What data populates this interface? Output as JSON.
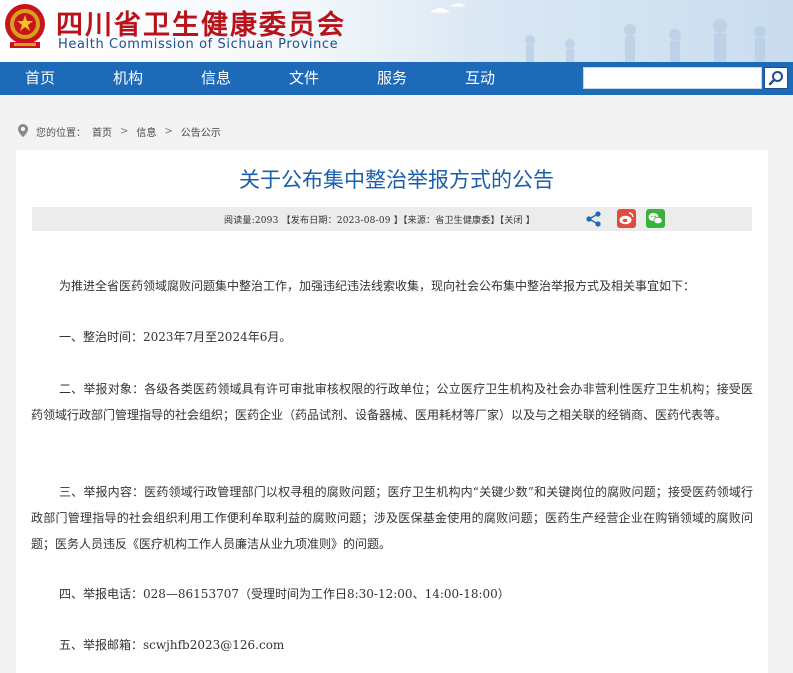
{
  "header": {
    "title_cn": "四川省卫生健康委员会",
    "title_en": "Health Commission of Sichuan Province"
  },
  "nav": {
    "items": [
      {
        "label": "首页"
      },
      {
        "label": "机构"
      },
      {
        "label": "信息"
      },
      {
        "label": "文件"
      },
      {
        "label": "服务"
      },
      {
        "label": "互动"
      }
    ]
  },
  "search": {
    "value": "",
    "icon": "search-icon"
  },
  "breadcrumb": {
    "prefix": "您的位置：",
    "items": [
      "首页",
      "信息",
      "公告公示"
    ],
    "separator": ">"
  },
  "article": {
    "title": "关于公布集中整治举报方式的公告",
    "meta": "阅读量:2093 【发布日期：2023-08-09 】【来源：省卫生健康委】【关闭 】",
    "paragraphs": [
      "为推进全省医药领域腐败问题集中整治工作，加强违纪违法线索收集，现向社会公布集中整治举报方式及相关事宜如下：",
      "一、整治时间：2023年7月至2024年6月。",
      "二、举报对象：各级各类医药领域具有许可审批审核权限的行政单位；公立医疗卫生机构及社会办非营利性医疗卫生机构；接受医药领域行政部门管理指导的社会组织；医药企业（药品试剂、设备器械、医用耗材等厂家）以及与之相关联的经销商、医药代表等。",
      "三、举报内容：医药领域行政管理部门以权寻租的腐败问题；医疗卫生机构内“关键少数”和关键岗位的腐败问题；接受医药领域行政部门管理指导的社会组织利用工作便利牟取利益的腐败问题；涉及医保基金使用的腐败问题；医药生产经营企业在购销领域的腐败问题；医务人员违反《医疗机构工作人员廉洁从业九项准则》的问题。",
      "四、举报电话：028—86153707（受理时间为工作日8:30-12:00、14:00-18:00）",
      "五、举报邮箱：scwjhfb2023@126.com"
    ]
  },
  "colors": {
    "nav_bg": "#1d6ab8",
    "title_red": "#b8131b",
    "article_title_blue": "#1a5fae"
  }
}
